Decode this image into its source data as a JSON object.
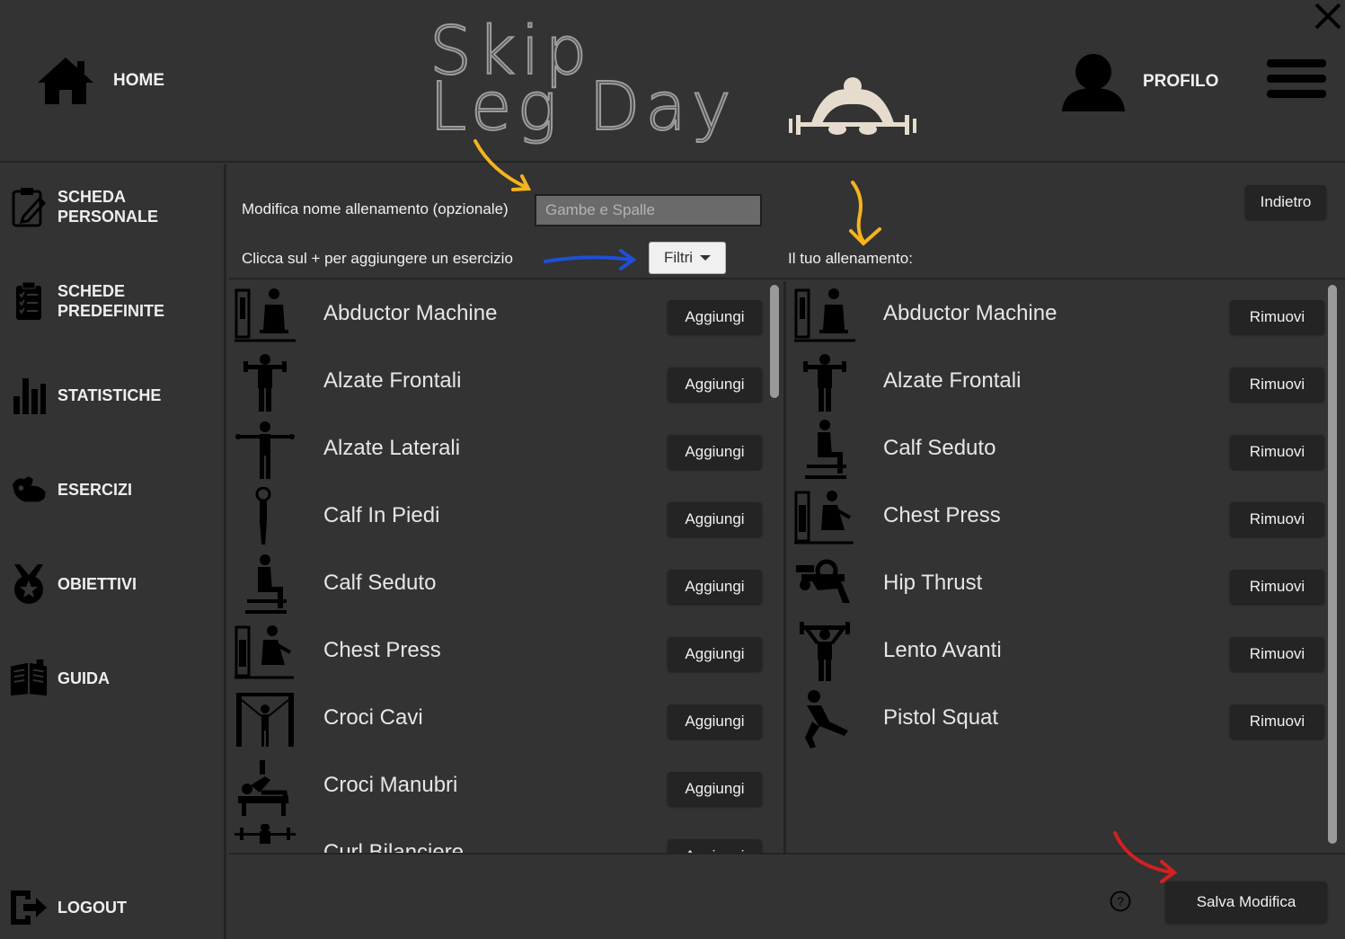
{
  "header": {
    "home_label": "HOME",
    "logo_line1": "Skip",
    "logo_line2": "Leg Day",
    "profile_label": "PROFILO"
  },
  "sidebar": {
    "items": [
      {
        "label": "SCHEDA\nPERSONALE",
        "icon": "clipboard-edit-icon"
      },
      {
        "label": "SCHEDE\nPREDEFINITE",
        "icon": "checklist-icon"
      },
      {
        "label": "STATISTICHE",
        "icon": "bar-chart-icon"
      },
      {
        "label": "ESERCIZI",
        "icon": "muscle-icon"
      },
      {
        "label": "OBIETTIVI",
        "icon": "medal-icon"
      },
      {
        "label": "GUIDA",
        "icon": "book-icon"
      }
    ],
    "logout_label": "LOGOUT"
  },
  "editor": {
    "name_label": "Modifica nome allenamento (opzionale)",
    "name_value": "Gambe e Spalle",
    "add_hint": "Clicca sul + per aggiungere un esercizio",
    "filter_label": "Filtri",
    "workout_label": "Il tuo allenamento:",
    "back_label": "Indietro",
    "save_label": "Salva Modifica",
    "help_icon": "?"
  },
  "available_exercises": [
    {
      "name": "Abductor Machine",
      "action": "Aggiungi",
      "icon": "machine-icon"
    },
    {
      "name": "Alzate Frontali",
      "action": "Aggiungi",
      "icon": "dumbbell-person-icon"
    },
    {
      "name": "Alzate Laterali",
      "action": "Aggiungi",
      "icon": "lateral-raise-icon"
    },
    {
      "name": "Calf In Piedi",
      "action": "Aggiungi",
      "icon": "standing-calf-icon"
    },
    {
      "name": "Calf Seduto",
      "action": "Aggiungi",
      "icon": "seated-calf-icon"
    },
    {
      "name": "Chest Press",
      "action": "Aggiungi",
      "icon": "chest-press-icon"
    },
    {
      "name": "Croci Cavi",
      "action": "Aggiungi",
      "icon": "cable-cross-icon"
    },
    {
      "name": "Croci Manubri",
      "action": "Aggiungi",
      "icon": "bench-fly-icon"
    },
    {
      "name": "Curl Bilanciere",
      "action": "Aggiungi",
      "icon": "barbell-curl-icon"
    }
  ],
  "workout_exercises": [
    {
      "name": "Abductor Machine",
      "action": "Rimuovi",
      "icon": "machine-icon"
    },
    {
      "name": "Alzate Frontali",
      "action": "Rimuovi",
      "icon": "dumbbell-person-icon"
    },
    {
      "name": "Calf Seduto",
      "action": "Rimuovi",
      "icon": "seated-calf-icon"
    },
    {
      "name": "Chest Press",
      "action": "Rimuovi",
      "icon": "chest-press-icon"
    },
    {
      "name": "Hip Thrust",
      "action": "Rimuovi",
      "icon": "hip-thrust-icon"
    },
    {
      "name": "Lento Avanti",
      "action": "Rimuovi",
      "icon": "shoulder-press-icon"
    },
    {
      "name": "Pistol Squat",
      "action": "Rimuovi",
      "icon": "pistol-squat-icon"
    }
  ],
  "colors": {
    "background": "#333333",
    "divider": "#242424",
    "button_dark": "#242424",
    "arrow_orange": "#f5b31f",
    "arrow_blue": "#1e4fd8",
    "arrow_red": "#d42020"
  }
}
